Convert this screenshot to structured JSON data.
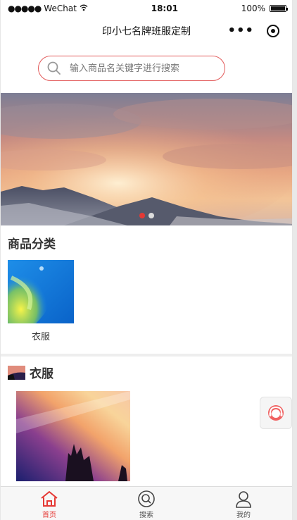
{
  "status_bar": {
    "carrier": "WeChat",
    "time": "18:01",
    "battery": "100%"
  },
  "nav": {
    "title": "印小七名牌班服定制"
  },
  "search": {
    "placeholder": "输入商品名关键字进行搜索"
  },
  "banner": {
    "slide_count": 2,
    "active_index": 0
  },
  "categories": {
    "title": "商品分类",
    "items": [
      {
        "label": "衣服"
      }
    ]
  },
  "group": {
    "title": "衣服"
  },
  "tabs": [
    {
      "label": "首页",
      "icon": "home-icon",
      "active": true
    },
    {
      "label": "搜索",
      "icon": "search-icon",
      "active": false
    },
    {
      "label": "我的",
      "icon": "user-icon",
      "active": false
    }
  ],
  "colors": {
    "accent": "#e53935",
    "search_border": "#e25a5a"
  }
}
